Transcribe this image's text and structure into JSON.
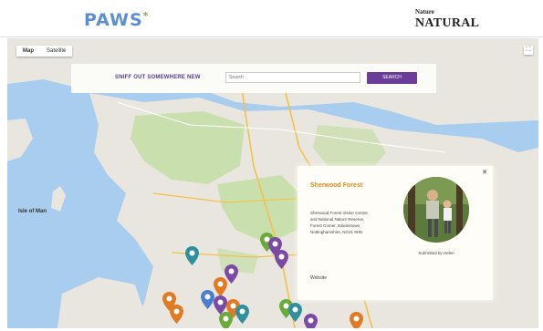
{
  "header": {
    "logo_left": "PAWS",
    "logo_left_mark": "*",
    "logo_right_small": "Nature",
    "logo_right_big": "NATURAL"
  },
  "map": {
    "type_tabs": [
      {
        "label": "Map",
        "active": true
      },
      {
        "label": "Satellite",
        "active": false
      }
    ],
    "fullscreen_icon": "fullscreen-icon",
    "search": {
      "label": "SNIFF OUT SOMEWHERE NEW",
      "placeholder": "Search",
      "button": "SEARCH"
    },
    "sea_label": "Isle of Man",
    "popup": {
      "title": "Sherwood Forest",
      "description": "Sherwood Forest Visitor Centre and National Nature Reserve, Forest Corner, Edwinstowe, Nottinghamshire, NG21 9HN",
      "website": "Website",
      "caption": "Submitted by Helen",
      "close_icon": "close-icon"
    },
    "colors": {
      "water": "#a9cdee",
      "land": "#e9e6df",
      "park": "#c9dfae",
      "pin_purple": "#7b4aa5",
      "pin_teal": "#2f8f9d",
      "pin_orange": "#e07b24",
      "pin_blue": "#4a7fd0",
      "pin_green": "#6aaa3a"
    }
  }
}
